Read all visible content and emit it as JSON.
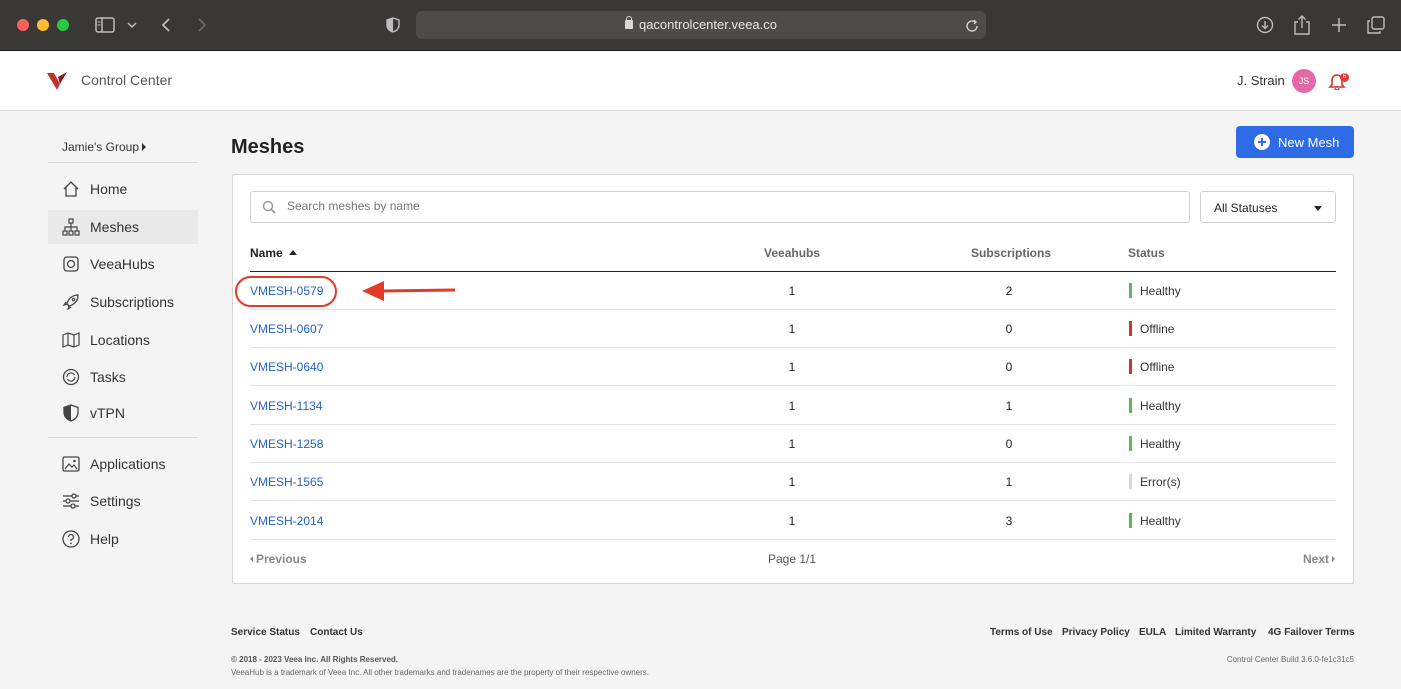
{
  "browser": {
    "url": "qacontrolcenter.veea.co"
  },
  "app": {
    "title": "Control Center",
    "user_name": "J. Strain",
    "avatar_initials": "JS",
    "notification_count": "6"
  },
  "sidebar": {
    "group": "Jamie's Group",
    "items": [
      {
        "label": "Home",
        "icon": "home-icon"
      },
      {
        "label": "Meshes",
        "icon": "mesh-icon",
        "active": true
      },
      {
        "label": "VeeaHubs",
        "icon": "veeahub-icon"
      },
      {
        "label": "Subscriptions",
        "icon": "rocket-icon"
      },
      {
        "label": "Locations",
        "icon": "map-icon"
      },
      {
        "label": "Tasks",
        "icon": "tasks-icon"
      },
      {
        "label": "vTPN",
        "icon": "shield-icon"
      }
    ],
    "items2": [
      {
        "label": "Applications",
        "icon": "applications-icon"
      },
      {
        "label": "Settings",
        "icon": "sliders-icon"
      },
      {
        "label": "Help",
        "icon": "help-icon"
      }
    ]
  },
  "main": {
    "title": "Meshes",
    "new_button": "New Mesh",
    "search_placeholder": "Search meshes by name",
    "status_filter": "All Statuses",
    "columns": {
      "name": "Name",
      "hubs": "Veeahubs",
      "subs": "Subscriptions",
      "status": "Status"
    },
    "rows": [
      {
        "name": "VMESH-0579",
        "hubs": "1",
        "subs": "2",
        "status": "Healthy"
      },
      {
        "name": "VMESH-0607",
        "hubs": "1",
        "subs": "0",
        "status": "Offline"
      },
      {
        "name": "VMESH-0640",
        "hubs": "1",
        "subs": "0",
        "status": "Offline"
      },
      {
        "name": "VMESH-1134",
        "hubs": "1",
        "subs": "1",
        "status": "Healthy"
      },
      {
        "name": "VMESH-1258",
        "hubs": "1",
        "subs": "0",
        "status": "Healthy"
      },
      {
        "name": "VMESH-1565",
        "hubs": "1",
        "subs": "1",
        "status": "Error(s)"
      },
      {
        "name": "VMESH-2014",
        "hubs": "1",
        "subs": "3",
        "status": "Healthy"
      }
    ],
    "pager": {
      "previous": "Previous",
      "page": "Page 1/1",
      "next": "Next"
    }
  },
  "status_colors": {
    "Healthy": "#5cb85c",
    "Offline": "#d0342c",
    "Error(s)": "#d8d8d8"
  },
  "footer": {
    "service_status": "Service Status",
    "contact_us": "Contact Us",
    "terms": "Terms of Use",
    "privacy": "Privacy Policy",
    "eula": "EULA",
    "warranty": "Limited Warranty",
    "failover": "4G Failover Terms",
    "copyright": "© 2018 - 2023 Veea Inc. All Rights Reserved.",
    "trademark": "VeeaHub is a trademark of Veea Inc. All other trademarks and tradenames are the property of their respective owners.",
    "build": "Control Center Build 3.6.0-fe1c31c5"
  }
}
